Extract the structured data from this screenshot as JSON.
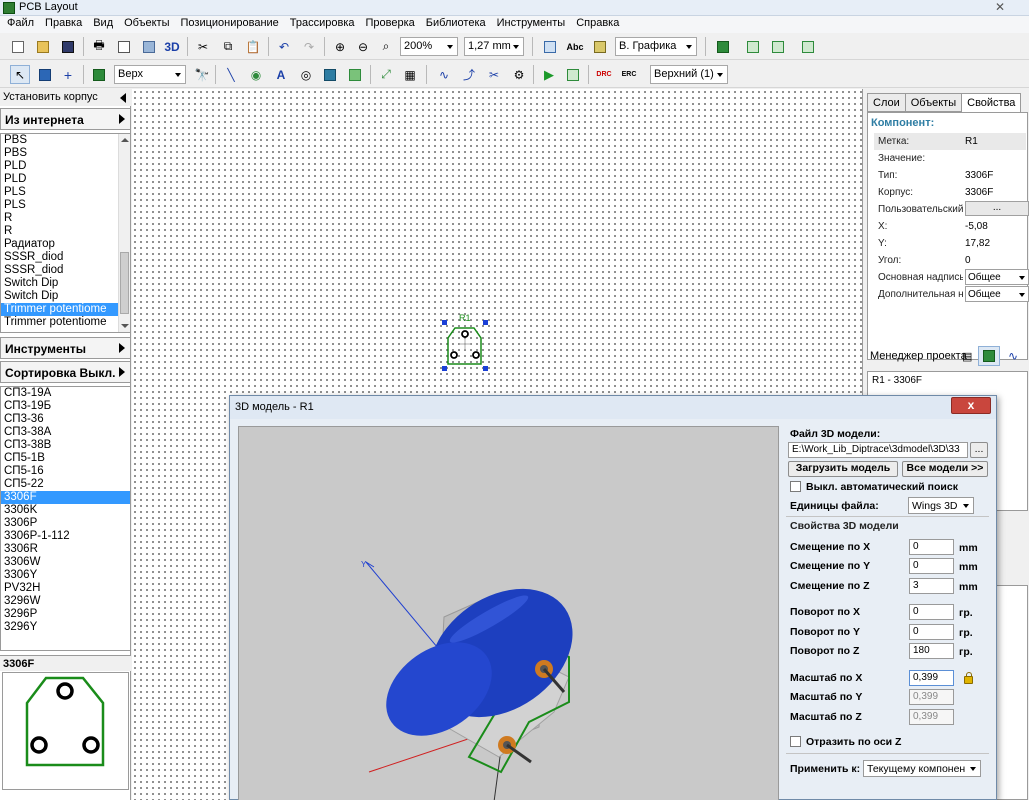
{
  "window": {
    "title": "PCB Layout"
  },
  "menu": [
    "Файл",
    "Правка",
    "Вид",
    "Объекты",
    "Позиционирование",
    "Трассировка",
    "Проверка",
    "Библиотека",
    "Инструменты",
    "Справка"
  ],
  "toolbar1": {
    "zoom": "200%",
    "grid": "1,27 mm",
    "view_mode": "В. Графика",
    "label_3d": "3D",
    "label_abc": "Abc"
  },
  "toolbar2": {
    "layer": "Верх",
    "side": "Верхний (1)"
  },
  "left_panel": {
    "header": "Установить корпус",
    "from_internet": "Из интернета",
    "library_list": [
      "PBS",
      "PBS",
      "PLD",
      "PLD",
      "PLS",
      "PLS",
      "R",
      "R",
      "Радиатор",
      "SSSR_diod",
      "SSSR_diod",
      "Switch Dip",
      "Switch Dip",
      "Trimmer potentiome",
      "Trimmer potentiome"
    ],
    "library_selected_index": 13,
    "tools_button": "Инструменты",
    "sort_button": "Сортировка Выкл.",
    "component_list": [
      "СП3-19А",
      "СП3-19Б",
      "СП3-36",
      "СП3-38А",
      "СП3-38В",
      "СП5-1В",
      "СП5-16",
      "СП5-22",
      "3306F",
      "3306K",
      "3306P",
      "3306P-1-112",
      "3306R",
      "3306W",
      "3306Y",
      "PV32H",
      "3296W",
      "3296P",
      "3296Y"
    ],
    "component_selected_index": 8,
    "preview_title": "3306F"
  },
  "canvas": {
    "component_label": "R1"
  },
  "right_panel": {
    "tabs": [
      "Слои",
      "Объекты",
      "Свойства"
    ],
    "active_tab": "Свойства",
    "section": "Компонент:",
    "props": [
      {
        "key": "Метка:",
        "value": "R1"
      },
      {
        "key": "Значение:",
        "value": ""
      },
      {
        "key": "Тип:",
        "value": "3306F"
      },
      {
        "key": "Корпус:",
        "value": "3306F"
      },
      {
        "key": "Пользовательский:",
        "value": "..."
      },
      {
        "key": "X:",
        "value": "-5,08"
      },
      {
        "key": "Y:",
        "value": "17,82"
      },
      {
        "key": "Угол:",
        "value": "0"
      },
      {
        "key": "Основная надпись:",
        "value": "Общее"
      },
      {
        "key": "Дополнительная надпись:",
        "value": "Общее"
      }
    ],
    "project_manager": "Менеджер проекта",
    "project_item": "R1 - 3306F"
  },
  "dialog": {
    "title": "3D модель - R1",
    "close": "x",
    "file_label": "Файл 3D модели:",
    "file_path": "E:\\Work_Lib_Diptrace\\3dmodel\\3D\\33",
    "browse": "...",
    "load_button": "Загрузить модель",
    "all_models_button": "Все модели >>",
    "auto_search": "Выкл. автоматический поиск",
    "units_label": "Единицы файла:",
    "units_value": "Wings 3D",
    "props_label": "Свойства 3D модели",
    "offset_x_label": "Смещение по X",
    "offset_x": "0",
    "offset_y_label": "Смещение по Y",
    "offset_y": "0",
    "offset_z_label": "Смещение по Z",
    "offset_z": "3",
    "rot_x_label": "Поворот по X",
    "rot_x": "0",
    "rot_y_label": "Поворот по Y",
    "rot_y": "0",
    "rot_z_label": "Поворот по Z",
    "rot_z": "180",
    "scale_x_label": "Масштаб по X",
    "scale_x": "0,399",
    "scale_y_label": "Масштаб по Y",
    "scale_y": "0,399",
    "scale_z_label": "Масштаб по Z",
    "scale_z": "0,399",
    "unit_mm": "mm",
    "unit_deg": "гр.",
    "mirror_z": "Отразить по оси Z",
    "apply_label": "Применить к:",
    "apply_value": "Текущему компонен"
  },
  "colors": {
    "selection": "#3399ff",
    "pcb_outline": "#1a8c1a",
    "model_blue": "#1d3fbf",
    "accent": "#2e7da3"
  }
}
